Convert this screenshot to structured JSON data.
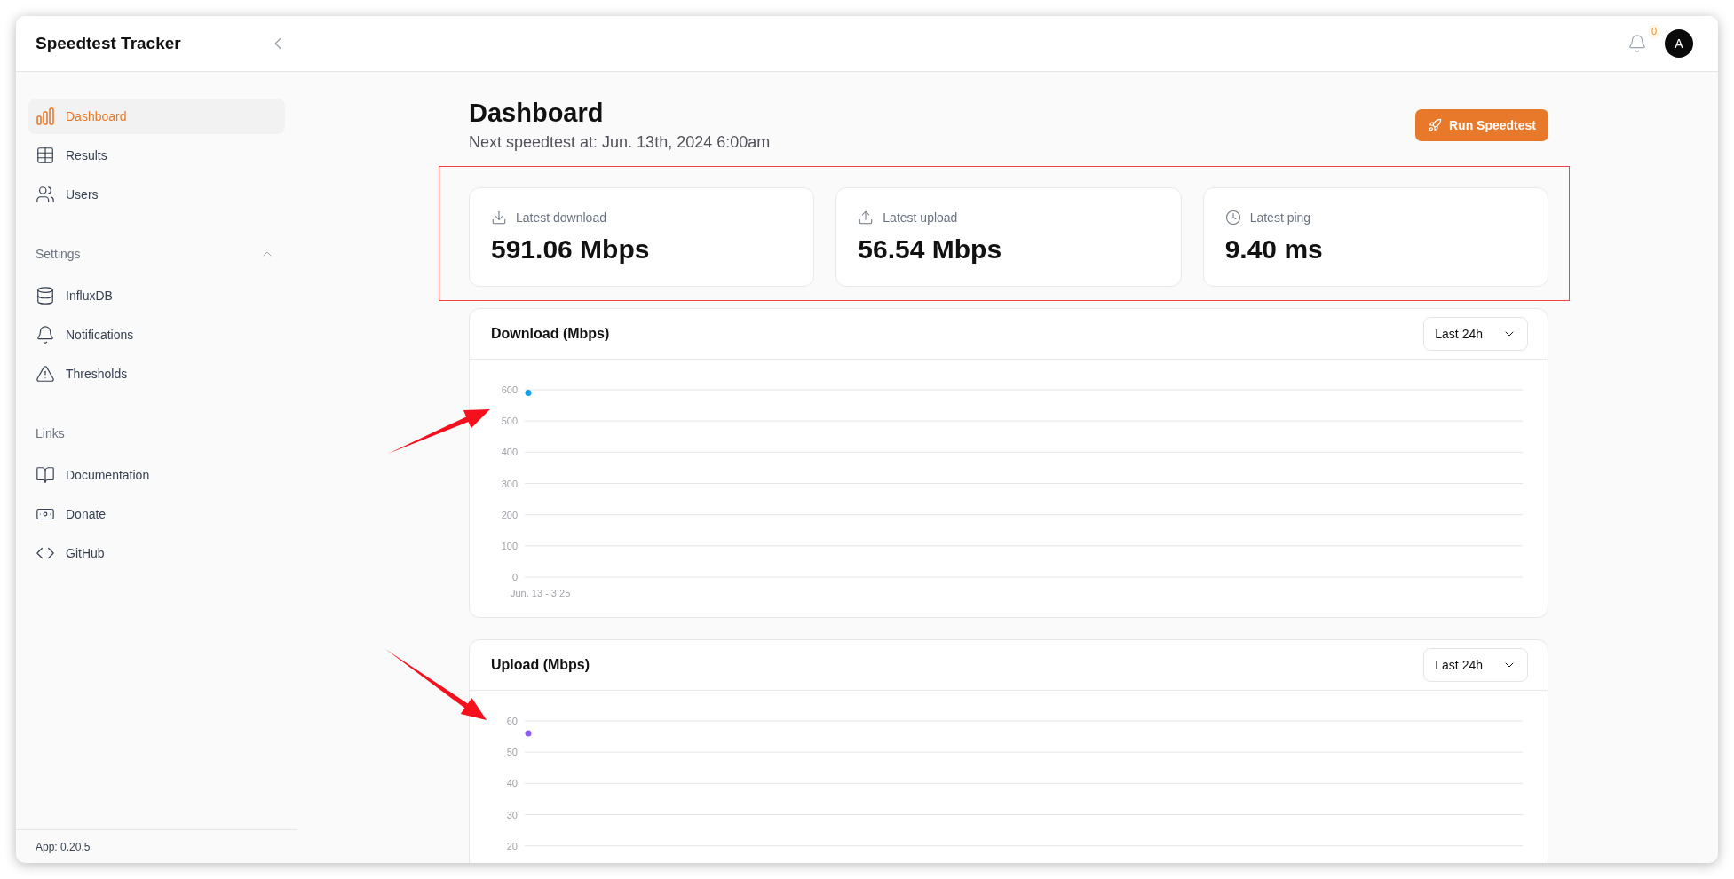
{
  "header": {
    "title": "Speedtest Tracker",
    "notification_count": "0",
    "avatar": "A"
  },
  "sidebar": {
    "groups": [
      {
        "items": [
          {
            "label": "Dashboard",
            "selected": true
          },
          {
            "label": "Results",
            "selected": false
          },
          {
            "label": "Users",
            "selected": false
          }
        ]
      },
      {
        "heading": "Settings",
        "expanded": true,
        "items": [
          {
            "label": "InfluxDB",
            "selected": false
          },
          {
            "label": "Notifications",
            "selected": false
          },
          {
            "label": "Thresholds",
            "selected": false
          }
        ]
      },
      {
        "heading": "Links",
        "items": [
          {
            "label": "Documentation",
            "selected": false
          },
          {
            "label": "Donate",
            "selected": false
          },
          {
            "label": "GitHub",
            "selected": false
          }
        ]
      }
    ],
    "footer": "App: 0.20.5"
  },
  "page": {
    "title": "Dashboard",
    "subtitle": "Next speedtest at: Jun. 13th, 2024 6:00am",
    "action": "Run Speedtest"
  },
  "stats": [
    {
      "kind": "download",
      "label": "Latest download",
      "value": "591.06 Mbps"
    },
    {
      "kind": "upload",
      "label": "Latest upload",
      "value": "56.54 Mbps"
    },
    {
      "kind": "ping",
      "label": "Latest ping",
      "value": "9.40 ms"
    }
  ],
  "charts": [
    {
      "title": "Download (Mbps)",
      "range": "Last 24h",
      "chart_data": {
        "type": "scatter",
        "grid": true,
        "categories": [
          "Jun. 13 - 3:25"
        ],
        "series": [
          {
            "color": "#0ea5e9",
            "values": [
              590
            ]
          }
        ],
        "ylim": [
          0,
          600
        ],
        "yticks": [
          0,
          100,
          200,
          300,
          400,
          500,
          600
        ]
      }
    },
    {
      "title": "Upload (Mbps)",
      "range": "Last 24h",
      "chart_data": {
        "type": "scatter",
        "grid": true,
        "series": [
          {
            "color": "#8b5cf6",
            "values": [
              56
            ]
          }
        ],
        "ylim": [
          20,
          60
        ],
        "yticks": [
          20,
          30,
          40,
          50,
          60
        ]
      }
    }
  ],
  "annotations": [
    {
      "kind": "frame"
    },
    {
      "kind": "arrow"
    },
    {
      "kind": "arrow"
    }
  ]
}
